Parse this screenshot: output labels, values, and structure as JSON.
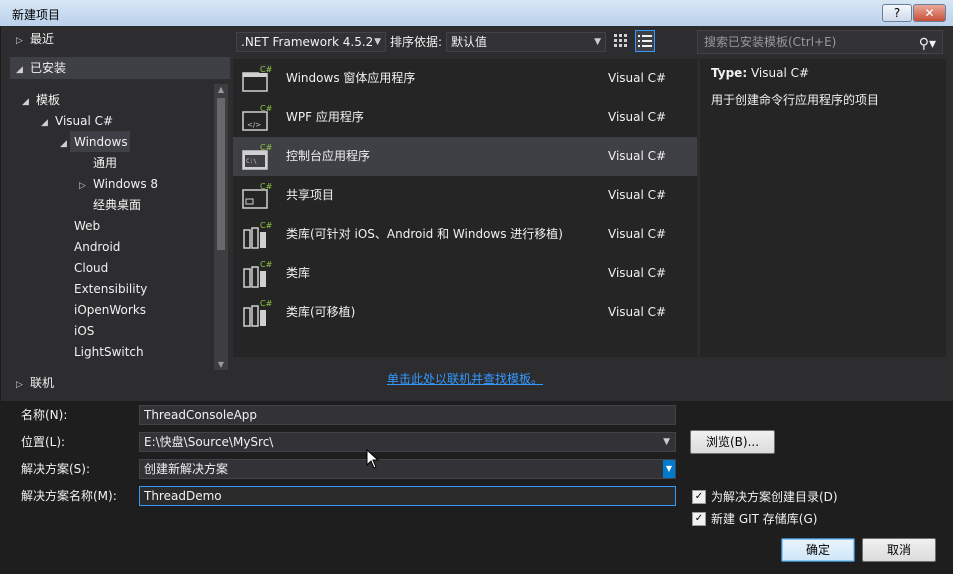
{
  "window": {
    "title": "新建项目",
    "help_label": "?",
    "close_label": "✕"
  },
  "left_tree": {
    "recent": "最近",
    "installed": "已安装",
    "templates": "模板",
    "visual_csharp": "Visual C#",
    "windows": "Windows",
    "windows_children": [
      "通用",
      "Windows 8",
      "经典桌面"
    ],
    "other_items": [
      "Web",
      "Android",
      "Cloud",
      "Extensibility",
      "iOpenWorks",
      "iOS",
      "LightSwitch"
    ],
    "online": "联机"
  },
  "toolbar": {
    "framework": ".NET Framework 4.5.2",
    "sort_label": "排序依据:",
    "sort_value": "默认值",
    "search_placeholder": "搜索已安装模板(Ctrl+E)"
  },
  "templates": [
    {
      "name": "Windows 窗体应用程序",
      "lang": "Visual C#",
      "icon": "winforms-icon"
    },
    {
      "name": "WPF 应用程序",
      "lang": "Visual C#",
      "icon": "wpf-icon"
    },
    {
      "name": "控制台应用程序",
      "lang": "Visual C#",
      "icon": "console-icon",
      "selected": true
    },
    {
      "name": "共享项目",
      "lang": "Visual C#",
      "icon": "shared-project-icon"
    },
    {
      "name": "类库(可针对 iOS、Android 和 Windows 进行移植)",
      "lang": "Visual C#",
      "icon": "portable-library-icon"
    },
    {
      "name": "类库",
      "lang": "Visual C#",
      "icon": "class-library-icon"
    },
    {
      "name": "类库(可移植)",
      "lang": "Visual C#",
      "icon": "portable-class-library-icon"
    }
  ],
  "description": {
    "type_label": "Type:",
    "type_value": "Visual C#",
    "text": "用于创建命令行应用程序的项目"
  },
  "online_link": "单击此处以联机并查找模板。",
  "form": {
    "name_label": "名称(N):",
    "name_value": "ThreadConsoleApp",
    "location_label": "位置(L):",
    "location_value": "E:\\快盘\\Source\\MySrc\\",
    "solution_label": "解决方案(S):",
    "solution_value": "创建新解决方案",
    "solution_name_label": "解决方案名称(M):",
    "solution_name_value": "ThreadDemo",
    "browse_label": "浏览(B)...",
    "create_dir_label": "为解决方案创建目录(D)",
    "git_label": "新建 GIT 存储库(G)",
    "ok_label": "确定",
    "cancel_label": "取消"
  },
  "colors": {
    "accent": "#3399ff",
    "selection": "#3f3f46",
    "background": "#2d2d30"
  }
}
